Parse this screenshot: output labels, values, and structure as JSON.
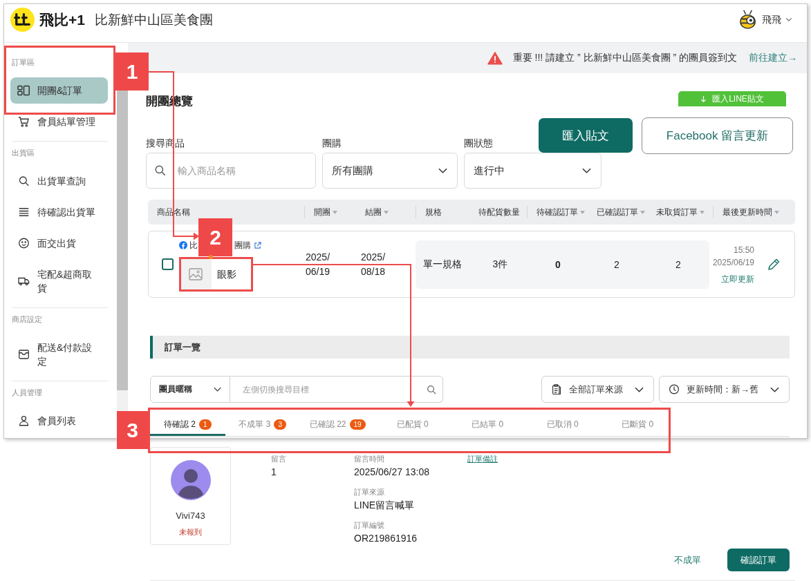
{
  "header": {
    "brand": "飛比+1",
    "store_name": "比新鮮中山區美食團",
    "user_name": "飛飛"
  },
  "sidebar": {
    "sections": [
      {
        "title": "訂單區",
        "items": [
          {
            "label": "開團&訂單",
            "selected": true
          },
          {
            "label": "會員結單管理",
            "selected": false
          }
        ]
      },
      {
        "title": "出貨區",
        "items": [
          {
            "label": "出貨單查詢",
            "selected": false
          },
          {
            "label": "待確認出貨單",
            "selected": false
          },
          {
            "label": "面交出貨",
            "selected": false
          },
          {
            "label": "宅配&超商取貨",
            "selected": false
          }
        ]
      },
      {
        "title": "商店設定",
        "items": [
          {
            "label": "配送&付款設定",
            "selected": false
          }
        ]
      },
      {
        "title": "人員管理",
        "items": [
          {
            "label": "會員列表",
            "selected": false
          }
        ]
      }
    ]
  },
  "notice": {
    "text": "重要 !!! 請建立 ” 比新鮮中山區美食團 ” 的團員簽到文",
    "link": "前往建立→"
  },
  "overview": {
    "title": "開團總覽",
    "line_import_button": "匯入LINE貼文",
    "import_button": "匯入貼文",
    "facebook_button": "Facebook 留言更新"
  },
  "filters": [
    {
      "kind": "search",
      "label": "搜尋商品",
      "placeholder": "輸入商品名稱"
    },
    {
      "kind": "select",
      "label": "團購",
      "value": "所有團購"
    },
    {
      "kind": "select",
      "label": "團狀態",
      "value": "進行中"
    }
  ],
  "table": {
    "columns": [
      {
        "label": "商品名稱",
        "sortable": false
      },
      {
        "label": "開團",
        "sortable": true
      },
      {
        "label": "結團",
        "sortable": true
      },
      {
        "label": "規格",
        "sortable": false
      },
      {
        "label": "待配貨數量",
        "sortable": false
      },
      {
        "label": "待確認訂單",
        "sortable": true
      },
      {
        "label": "已確認訂單",
        "sortable": true
      },
      {
        "label": "未取貨訂單",
        "sortable": true
      },
      {
        "label": "最後更新時間",
        "sortable": true
      }
    ],
    "rows": [
      {
        "checked": false,
        "group_name_start": "比",
        "group_name_end": "團購",
        "product": "眼影",
        "open_date": "2025/06/19",
        "close_date": "2025/08/18",
        "spec": "單一規格",
        "pending_qty": "3件",
        "unconfirmed": "0",
        "confirmed": "2",
        "unpicked": "2",
        "updated_time": "15:50",
        "updated_date": "2025/06/19",
        "update_link": "立即更新"
      }
    ]
  },
  "orders": {
    "title": "訂單一覽",
    "search_target": "團員暱稱",
    "search_placeholder": "左側切換搜尋目標",
    "source_filter": "全部訂單來源",
    "sort_filter": "更新時間：新→舊",
    "tabs": [
      {
        "label": "待確認 2",
        "badge": "1",
        "selected": true
      },
      {
        "label": "不成單 3",
        "badge": "3",
        "selected": false
      },
      {
        "label": "已確認 22",
        "badge": "19",
        "selected": false
      },
      {
        "label": "已配貨 0",
        "selected": false
      },
      {
        "label": "已結單 0",
        "selected": false
      },
      {
        "label": "已取消 0",
        "selected": false
      },
      {
        "label": "已斷貨 0",
        "selected": false
      }
    ],
    "order": {
      "member_name": "Vivi743",
      "member_status": "未報到",
      "field_columns": [
        [
          {
            "label": "留言",
            "value": "1"
          }
        ],
        [
          {
            "label": "留言時間",
            "value": "2025/06/27 13:08"
          },
          {
            "label": "訂單來源",
            "value": "LINE留言喊單"
          },
          {
            "label": "訂單編號",
            "value": "OR219861916"
          }
        ]
      ],
      "note_link": "訂單備註",
      "reject_button": "不成單",
      "confirm_button": "確認訂單"
    }
  },
  "callouts": [
    {
      "number": "1"
    },
    {
      "number": "2"
    },
    {
      "number": "3"
    }
  ]
}
